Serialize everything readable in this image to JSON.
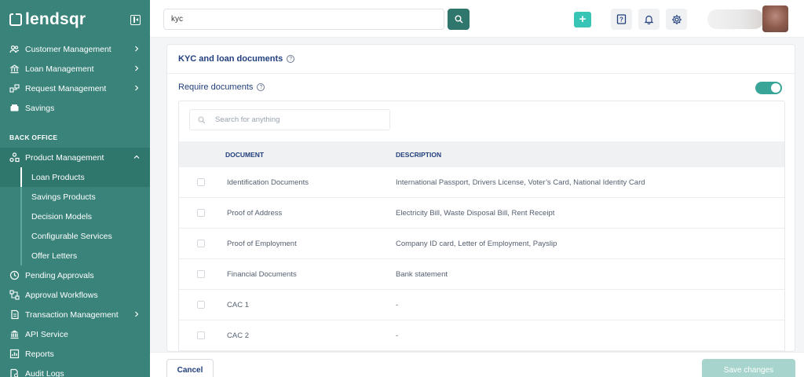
{
  "brand": {
    "name": "lendsqr"
  },
  "sidebar": {
    "top_items": [
      {
        "label": "Customer Management",
        "icon": "users-icon",
        "has_chevron": true
      },
      {
        "label": "Loan Management",
        "icon": "loan-icon",
        "has_chevron": true
      },
      {
        "label": "Request Management",
        "icon": "request-icon",
        "has_chevron": true
      },
      {
        "label": "Savings",
        "icon": "savings-icon",
        "has_chevron": false
      }
    ],
    "section_label": "BACK OFFICE",
    "product_management": {
      "label": "Product Management",
      "icon": "product-icon",
      "expanded": true
    },
    "sub_items": [
      {
        "label": "Loan Products",
        "active": true
      },
      {
        "label": "Savings Products",
        "active": false
      },
      {
        "label": "Decision Models",
        "active": false
      },
      {
        "label": "Configurable Services",
        "active": false
      },
      {
        "label": "Offer Letters",
        "active": false
      }
    ],
    "bottom_items": [
      {
        "label": "Pending Approvals",
        "icon": "clock-icon",
        "has_chevron": false
      },
      {
        "label": "Approval Workflows",
        "icon": "workflow-icon",
        "has_chevron": false
      },
      {
        "label": "Transaction Management",
        "icon": "transaction-icon",
        "has_chevron": true
      },
      {
        "label": "API Service",
        "icon": "bank-icon",
        "has_chevron": false
      },
      {
        "label": "Reports",
        "icon": "reports-icon",
        "has_chevron": false
      },
      {
        "label": "Audit Logs",
        "icon": "audit-icon",
        "has_chevron": false
      }
    ]
  },
  "topbar": {
    "search_value": "kyc",
    "plus_label": "+"
  },
  "card": {
    "title": "KYC and loan documents",
    "require_label": "Require documents",
    "require_enabled": true,
    "search_placeholder": "Search for anything",
    "columns": [
      "DOCUMENT",
      "DESCRIPTION"
    ],
    "rows": [
      {
        "document": "Identification Documents",
        "description": "International Passport, Drivers License, Voter’s Card, National Identity Card"
      },
      {
        "document": "Proof of Address",
        "description": "Electricity Bill, Waste Disposal Bill, Rent Receipt"
      },
      {
        "document": "Proof of Employment",
        "description": "Company ID card, Letter of Employment, Payslip"
      },
      {
        "document": "Financial Documents",
        "description": "Bank statement"
      },
      {
        "document": "CAC 1",
        "description": "-"
      },
      {
        "document": "CAC 2",
        "description": "-"
      }
    ]
  },
  "footer": {
    "cancel_label": "Cancel",
    "save_label": "Save changes"
  },
  "colors": {
    "sidebar": "#39837a",
    "accent": "#2f766d",
    "toggle": "#39a598",
    "save_disabled": "#a7d4cc",
    "text_primary": "#213f7d"
  }
}
